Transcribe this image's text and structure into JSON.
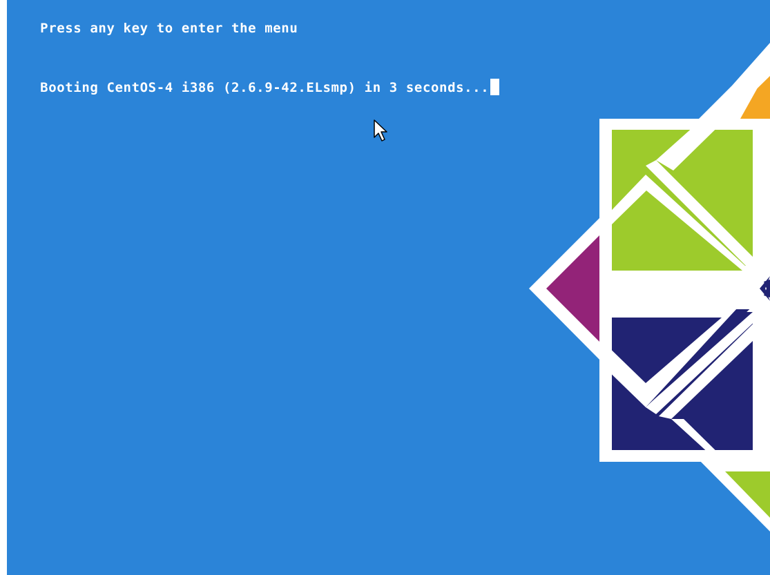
{
  "boot_screen": {
    "prompt_text": "Press any key to enter the menu",
    "boot_message": "Booting CentOS-4 i386 (2.6.9-42.ELsmp) in 3 seconds..."
  },
  "colors": {
    "background": "#2b84d8",
    "text": "#ffffff",
    "logo_green": "#9dcb2c",
    "logo_orange": "#f4a623",
    "logo_purple": "#932378",
    "logo_navy": "#212373",
    "logo_white": "#ffffff"
  },
  "icons": {
    "cursor": "mouse-pointer-icon",
    "logo": "centos-logo"
  }
}
